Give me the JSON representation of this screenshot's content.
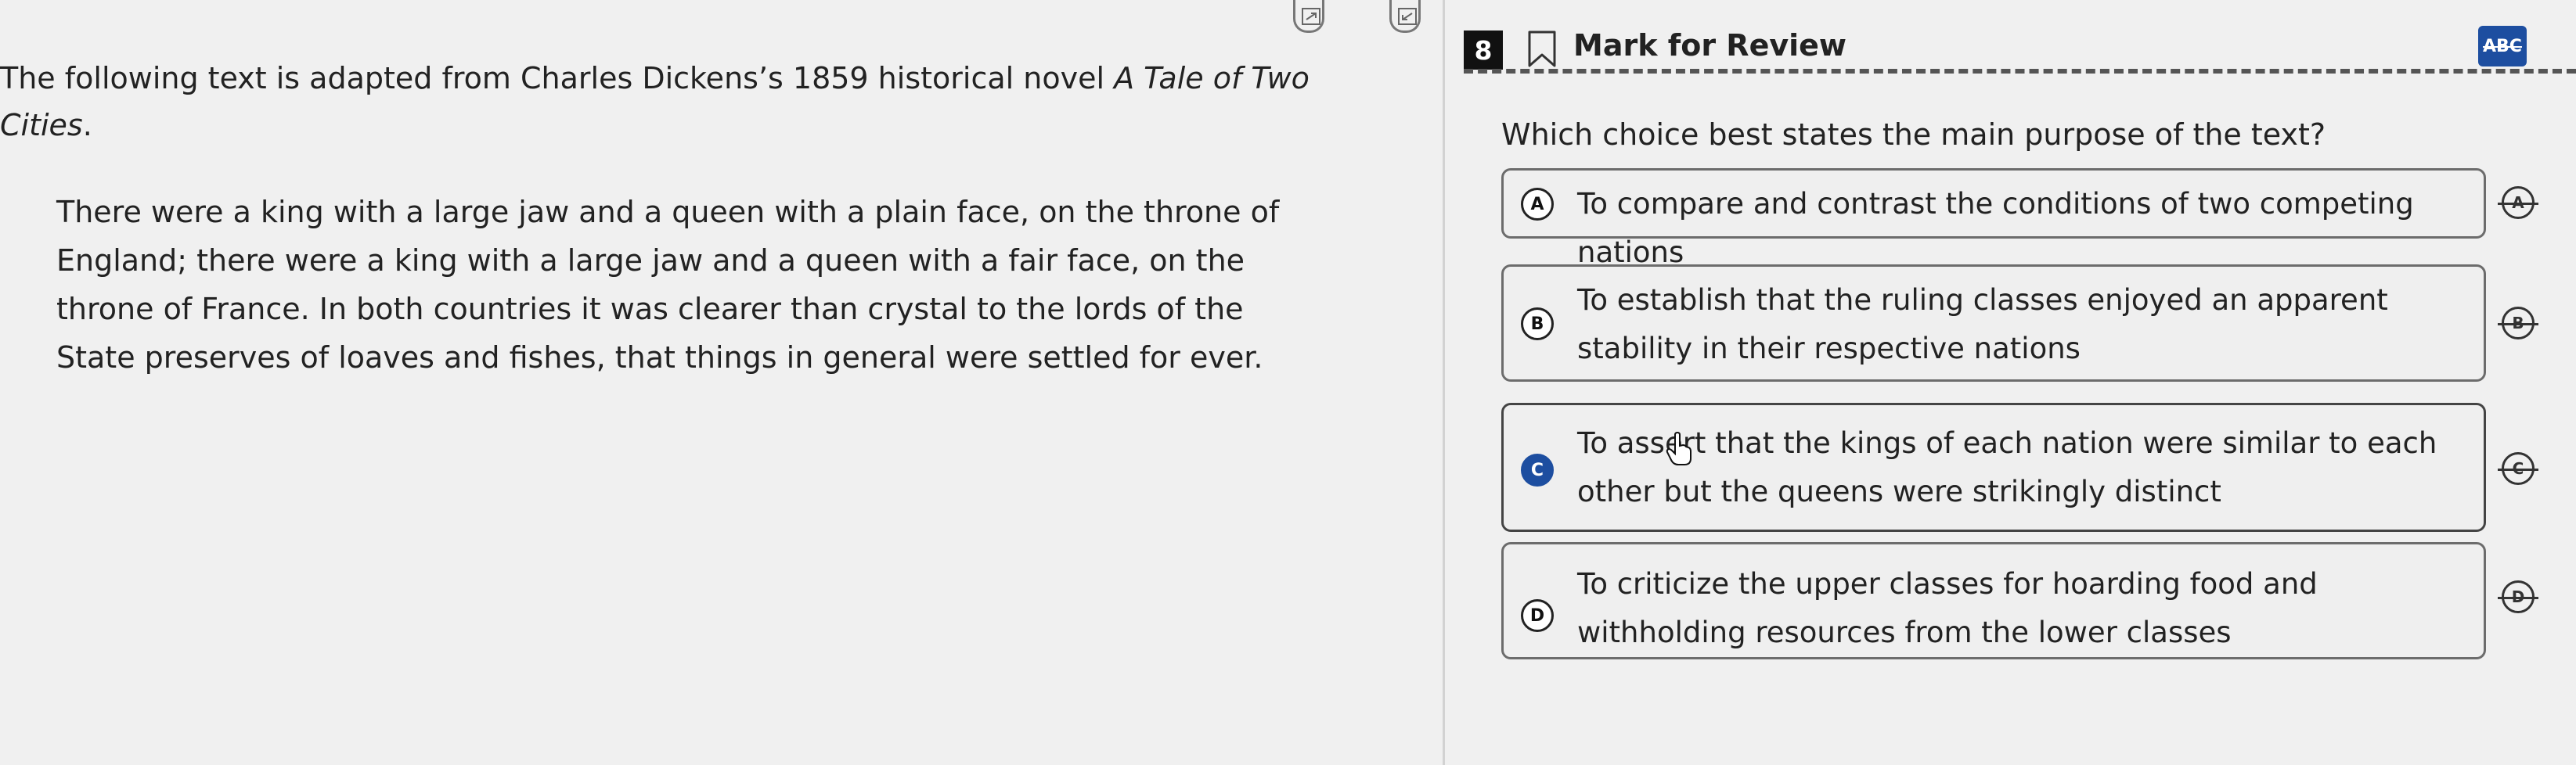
{
  "header": {
    "question_number": "8",
    "mark_for_review": "Mark for Review",
    "abc_label": "ABC"
  },
  "passage": {
    "intro_before": "The following text is adapted from Charles Dickens’s 1859 historical novel ",
    "intro_title": "A Tale of Two Cities",
    "intro_after": ".",
    "body": "There were a king with a large jaw and a queen with a plain face, on the throne of England; there were a king with a large jaw and a queen with a fair face, on the throne of France. In both countries it was clearer than crystal to the lords of the State preserves of loaves and fishes, that things in general were settled for ever."
  },
  "question": {
    "prompt": "Which choice best states the main purpose of the text?",
    "selected": "C",
    "choices": [
      {
        "letter": "A",
        "text": "To compare and contrast the conditions of two competing nations"
      },
      {
        "letter": "B",
        "text": "To establish that the ruling classes enjoyed an apparent stability in their respective nations"
      },
      {
        "letter": "C",
        "text": "To assert that the kings of each nation were similar to each other but the queens were strikingly distinct"
      },
      {
        "letter": "D",
        "text": "To criticize the upper classes for hoarding food and withholding resources from the lower classes"
      }
    ]
  },
  "colors": {
    "accent": "#1d4ea0",
    "background": "#f0f0f0"
  }
}
